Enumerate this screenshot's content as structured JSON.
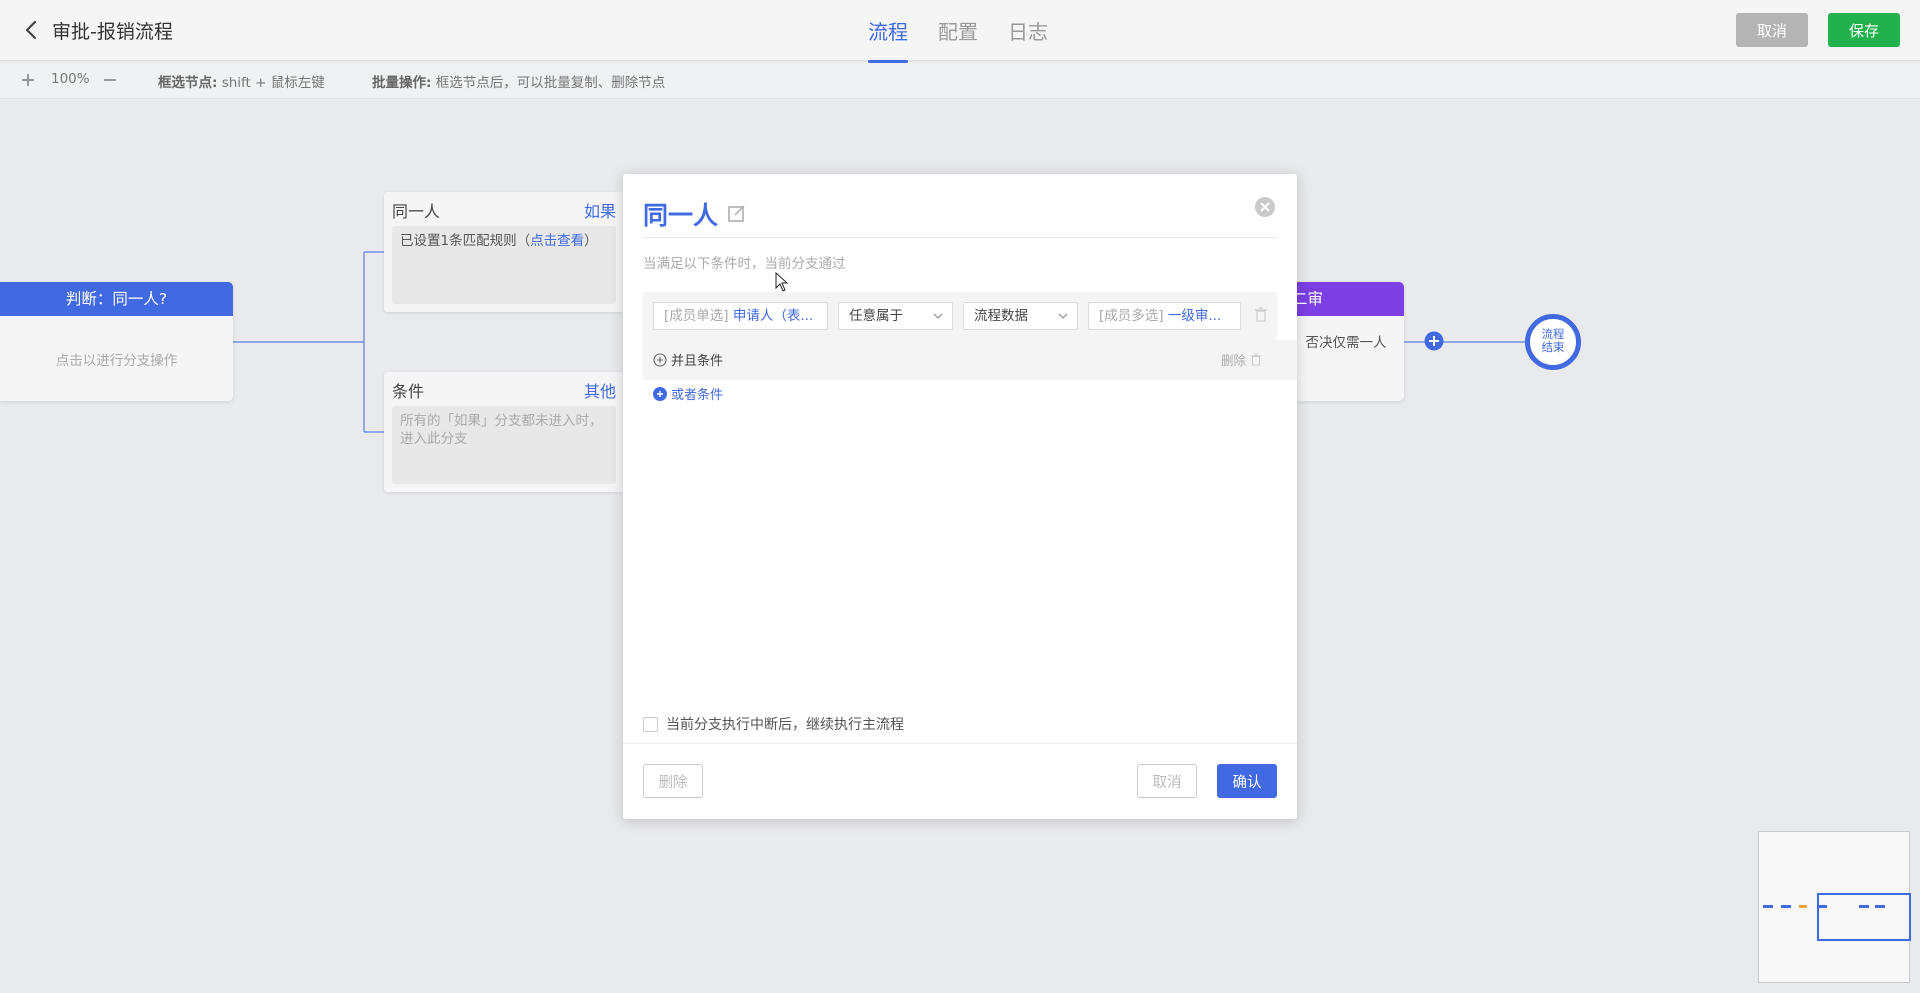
{
  "header": {
    "title": "审批-报销流程",
    "tabs": [
      {
        "label": "流程",
        "active": true
      },
      {
        "label": "配置",
        "active": false
      },
      {
        "label": "日志",
        "active": false
      }
    ],
    "cancel_label": "取消",
    "save_label": "保存"
  },
  "toolbar": {
    "zoom": "100%",
    "select_hint_label": "框选节点:",
    "select_hint_text": "shift + 鼠标左键",
    "batch_hint_label": "批量操作:",
    "batch_hint_text": "框选节点后，可以批量复制、删除节点"
  },
  "canvas": {
    "judge_node": {
      "title": "判断：同一人?",
      "body": "点击以进行分支操作"
    },
    "branch_same": {
      "name": "同一人",
      "tag": "如果",
      "body_prefix": "已设置1条匹配规则（",
      "body_link": "点击查看",
      "body_suffix": "）"
    },
    "branch_else": {
      "name": "条件",
      "tag": "其他",
      "body": "所有的「如果」分支都未进入时，进入此分支"
    },
    "review_node": {
      "title": "二审",
      "body": "，否决仅需一人"
    },
    "end_node": {
      "line1": "流程",
      "line2": "结束"
    }
  },
  "modal": {
    "title": "同一人",
    "description": "当满足以下条件时，当前分支通过",
    "condition": {
      "field_placeholder": "[成员单选]",
      "field_value": "申请人（表...",
      "operator": "任意属于",
      "source": "流程数据",
      "target_placeholder": "[成员多选]",
      "target_value": "一级审..."
    },
    "and_label": "并且条件",
    "delete_label": "删除",
    "or_label": "或者条件",
    "continue_label": "当前分支执行中断后，继续执行主流程",
    "continue_checked": false,
    "delete_button": "删除",
    "cancel_button": "取消",
    "confirm_button": "确认"
  },
  "colors": {
    "primary": "#4169e1",
    "success": "#22b14c",
    "purple": "#7b3fe4"
  }
}
